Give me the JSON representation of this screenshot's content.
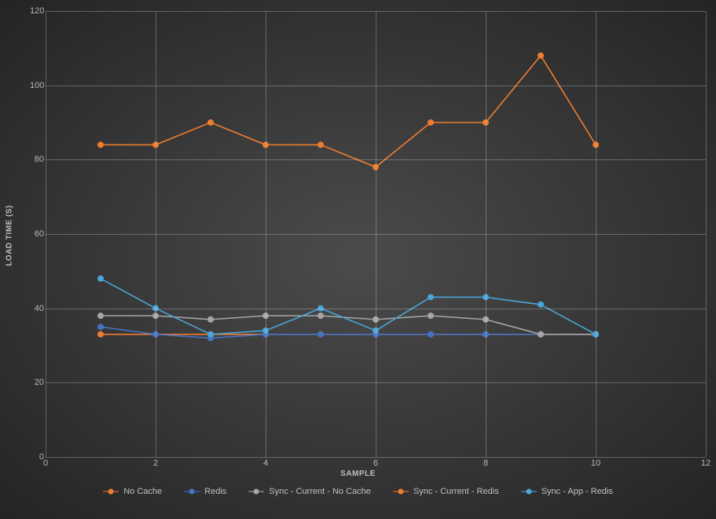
{
  "chart_data": {
    "type": "line",
    "xlabel": "SAMPLE",
    "ylabel": "LOAD TIME (S)",
    "xlim": [
      0,
      12
    ],
    "ylim": [
      0,
      120
    ],
    "x_ticks": [
      0,
      2,
      4,
      6,
      8,
      10,
      12
    ],
    "y_ticks": [
      0,
      20,
      40,
      60,
      80,
      100,
      120
    ],
    "x": [
      1,
      2,
      3,
      4,
      5,
      6,
      7,
      8,
      9,
      10
    ],
    "series": [
      {
        "name": "No Cache",
        "color": "#ed7d31",
        "values": [
          33,
          33,
          33,
          33,
          33,
          33,
          33,
          33,
          33,
          33
        ]
      },
      {
        "name": "Redis",
        "color": "#4472c4",
        "values": [
          35,
          33,
          32,
          33,
          33,
          33,
          33,
          33,
          33,
          33
        ]
      },
      {
        "name": "Sync - Current - No Cache",
        "color": "#a6a6a6",
        "values": [
          38,
          38,
          37,
          38,
          38,
          37,
          38,
          37,
          33,
          33
        ]
      },
      {
        "name": "Sync - Current - Redis",
        "color": "#ed7d31",
        "values": [
          84,
          84,
          90,
          84,
          84,
          78,
          90,
          90,
          108,
          84
        ]
      },
      {
        "name": "Sync - App - Redis",
        "color": "#4aa5d8",
        "values": [
          48,
          40,
          33,
          34,
          40,
          34,
          43,
          43,
          41,
          33
        ]
      }
    ]
  }
}
